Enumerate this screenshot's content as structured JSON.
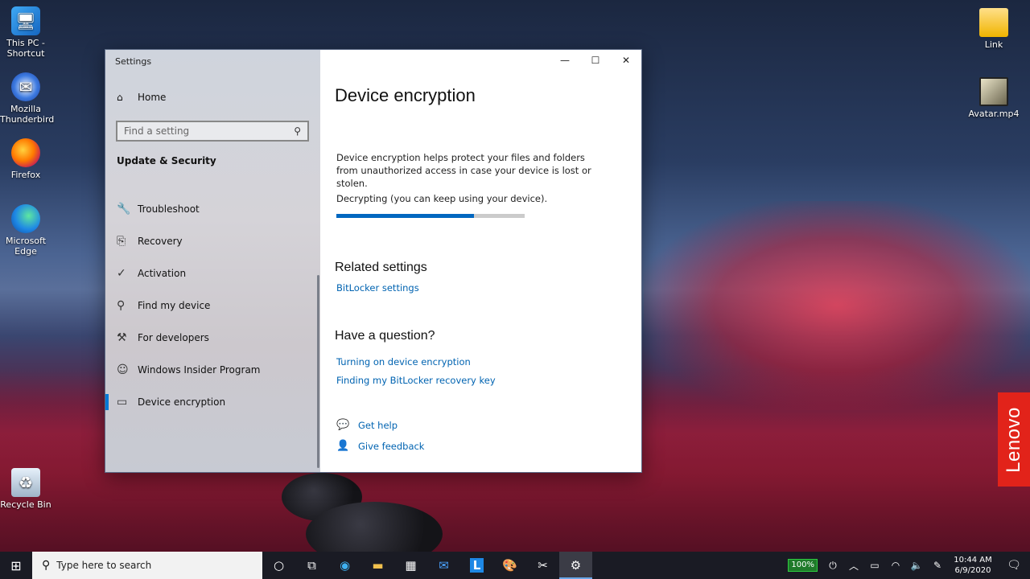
{
  "desktop": {
    "icons": [
      {
        "label_line1": "This PC -",
        "label_line2": "Shortcut",
        "icon": "computer-icon"
      },
      {
        "label_line1": "Mozilla",
        "label_line2": "Thunderbird",
        "icon": "thunderbird-icon"
      },
      {
        "label_line1": "Firefox",
        "label_line2": "",
        "icon": "firefox-icon"
      },
      {
        "label_line1": "Microsoft",
        "label_line2": "Edge",
        "icon": "edge-icon"
      },
      {
        "label_line1": "Recycle Bin",
        "label_line2": "",
        "icon": "recycle-bin-icon"
      },
      {
        "label_line1": "Link",
        "label_line2": "",
        "icon": "folder-icon"
      },
      {
        "label_line1": "Avatar.mp4",
        "label_line2": "",
        "icon": "video-file-icon"
      }
    ],
    "brand": "Lenovo"
  },
  "window": {
    "app_title": "Settings",
    "nav": {
      "home_label": "Home",
      "search_placeholder": "Find a setting",
      "section_title": "Update & Security",
      "items": [
        {
          "label": "Troubleshoot",
          "icon": "wrench-icon"
        },
        {
          "label": "Recovery",
          "icon": "recovery-icon"
        },
        {
          "label": "Activation",
          "icon": "check-circle-icon"
        },
        {
          "label": "Find my device",
          "icon": "person-location-icon"
        },
        {
          "label": "For developers",
          "icon": "developer-tools-icon"
        },
        {
          "label": "Windows Insider Program",
          "icon": "insider-cat-icon"
        },
        {
          "label": "Device encryption",
          "icon": "device-encryption-icon",
          "selected": true
        }
      ]
    },
    "content": {
      "title": "Device encryption",
      "description": "Device encryption helps protect your files and folders from unauthorized access in case your device is lost or stolen.",
      "status": "Decrypting (you can keep using your device).",
      "progress_fraction": 0.73,
      "related_heading": "Related settings",
      "related_links": [
        "BitLocker settings"
      ],
      "question_heading": "Have a question?",
      "question_links": [
        "Turning on device encryption",
        "Finding my BitLocker recovery key"
      ],
      "help_label": "Get help",
      "feedback_label": "Give feedback"
    }
  },
  "taskbar": {
    "search_placeholder": "Type here to search",
    "apps": [
      "cortana-icon",
      "task-view-icon",
      "edge-icon",
      "file-explorer-icon",
      "store-icon",
      "mail-icon",
      "lenovo-vantage-icon",
      "paint-icon",
      "snipping-icon",
      "settings-gear-icon"
    ],
    "battery_percent": "100%",
    "time": "10:44 AM",
    "date": "6/9/2020"
  },
  "colors": {
    "accent": "#0078d7",
    "link": "#0063b1",
    "taskbar": "#1a1b24",
    "brand_red": "#e2231a"
  }
}
